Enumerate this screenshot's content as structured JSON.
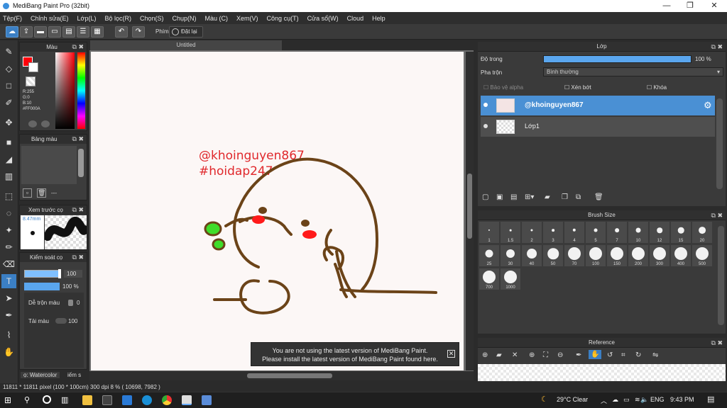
{
  "window": {
    "title": "MediBang Paint Pro (32bit)",
    "minimize": "—",
    "maximize": "❐",
    "close": "✕"
  },
  "menu": [
    "Tệp(F)",
    "Chỉnh sửa(E)",
    "Lớp(L)",
    "Bộ lọc(R)",
    "Chọn(S)",
    "Chụp(N)",
    "Màu (C)",
    "Xem(V)",
    "Công cụ(T)",
    "Cửa sổ(W)",
    "Cloud",
    "Help"
  ],
  "toolbar": {
    "key_label": "Phím",
    "reset_label": "Đặt lại"
  },
  "color_panel": {
    "title": "Màu",
    "r": "R:255",
    "g": "G:0",
    "b": "B:10",
    "hex": "#FF000A",
    "primary_color": "#ff000a"
  },
  "palette_panel": {
    "title": "Bảng màu",
    "count": "---"
  },
  "preview_panel": {
    "title": "Xem trước cọ",
    "size": "8.47mm"
  },
  "control_panel": {
    "title": "Kiểm soát cọ",
    "size_value": "100",
    "opacity_value": "100 %",
    "blend_label": "Dễ trộn màu",
    "blend_value": "0",
    "refill_label": "Tải màu",
    "refill_value": "100"
  },
  "bottom_tabs": {
    "tab1": "ọ: Watercolor",
    "tab2": "iếm s"
  },
  "canvas": {
    "tab_title": "Untitled",
    "text_line1": "@khoinguyen867",
    "text_line2": "#hoidap247"
  },
  "notice": {
    "line1": "You are not using the latest version of MediBang Paint.",
    "line2": "Please install the latest version of MediBang Paint found here."
  },
  "status": {
    "text": "11811 * 11811 pixel  (100 * 100cm)  300 dpi  8 %  ( 10698, 7982 )"
  },
  "layer_panel": {
    "title": "Lớp",
    "opacity_label": "Độ trong",
    "opacity_value": "100 %",
    "opacity_fraction": 1.0,
    "blend_label": "Pha trộn",
    "blend_value": "Bình thường",
    "protect_alpha": "Bảo vệ alpha",
    "clipping": "Xén bớt",
    "lock": "Khóa",
    "layers": [
      {
        "name": "@khoinguyen867",
        "selected": true
      },
      {
        "name": "Lớp1",
        "selected": false
      }
    ]
  },
  "brush_size_panel": {
    "title": "Brush Size",
    "sizes": [
      "1",
      "1.5",
      "2",
      "3",
      "4",
      "5",
      "7",
      "10",
      "12",
      "15",
      "20",
      "25",
      "30",
      "40",
      "50",
      "70",
      "100",
      "150",
      "200",
      "300",
      "400",
      "500",
      "700",
      "1000"
    ]
  },
  "reference_panel": {
    "title": "Reference"
  },
  "taskbar": {
    "weather": "29°C  Clear",
    "lang": "ENG",
    "time": "9:43 PM"
  }
}
